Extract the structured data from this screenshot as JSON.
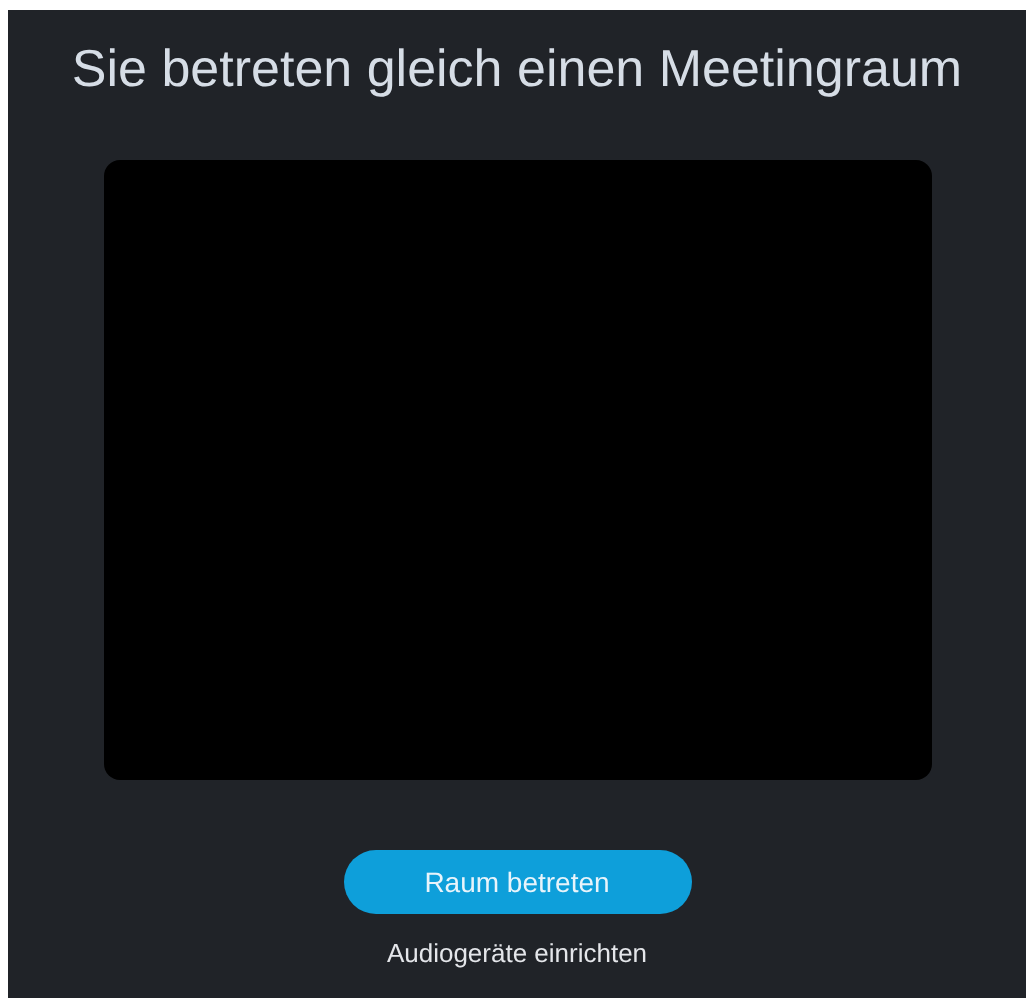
{
  "title": "Sie betreten gleich einen Meetingraum",
  "video_preview": {
    "kind": "empty"
  },
  "buttons": [
    {
      "label": "Raum betreten",
      "kind": "primary"
    },
    {
      "label": "Audiogeräte einrichten",
      "kind": "link"
    }
  ]
}
